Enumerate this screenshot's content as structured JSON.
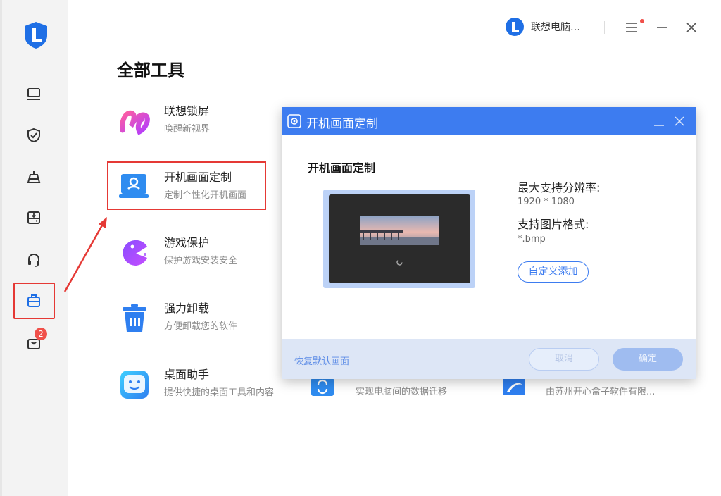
{
  "sidebar": {
    "items": [
      {
        "icon": "monitor-icon"
      },
      {
        "icon": "shield-check-icon"
      },
      {
        "icon": "broom-icon"
      },
      {
        "icon": "drive-icon"
      },
      {
        "icon": "headset-icon"
      },
      {
        "icon": "toolbox-icon",
        "active": true
      },
      {
        "icon": "bag-icon",
        "badge": "2"
      }
    ]
  },
  "header": {
    "brand_name": "联想电脑…",
    "accent": "#3d7cf0"
  },
  "page_title": "全部工具",
  "tools": [
    {
      "name": "联想锁屏",
      "desc": "唤醒新视界",
      "icon": "lockscreen-icon"
    },
    {
      "name": "开机画面定制",
      "desc": "定制个性化开机画面",
      "icon": "boot-screen-icon",
      "highlighted": true
    },
    {
      "name": "游戏保护",
      "desc": "保护游戏安装安全",
      "icon": "game-protect-icon"
    },
    {
      "name": "强力卸载",
      "desc": "方便卸载您的软件",
      "icon": "uninstall-icon"
    },
    {
      "name": "桌面助手",
      "desc": "提供快捷的桌面工具和内容",
      "icon": "desktop-assistant-icon"
    }
  ],
  "tools_partial": [
    {
      "desc": "实现电脑间的数据迁移",
      "icon": "data-migrate-icon"
    },
    {
      "desc": "由苏州开心盒子软件有限...",
      "icon": "app-store-icon"
    }
  ],
  "dialog": {
    "header_title": "开机画面定制",
    "title": "开机画面定制",
    "resolution_label": "最大支持分辨率:",
    "resolution_value": "1920 * 1080",
    "format_label": "支持图片格式:",
    "format_value": "*.bmp",
    "custom_add": "自定义添加",
    "restore_default": "恢复默认画面",
    "cancel": "取消",
    "ok": "确定"
  }
}
